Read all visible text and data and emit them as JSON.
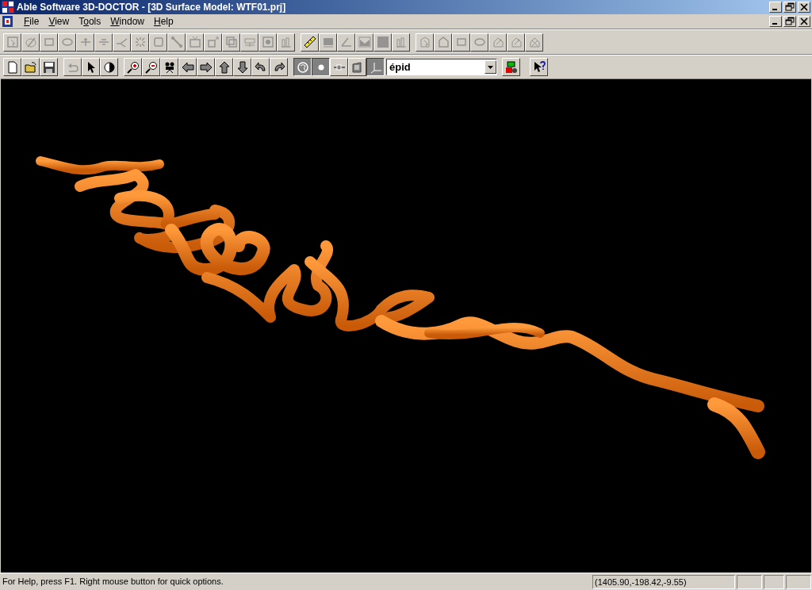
{
  "window": {
    "title": "Able Software 3D-DOCTOR - [3D Surface Model: WTF01.prj]"
  },
  "menu": [
    "File",
    "View",
    "Tools",
    "Window",
    "Help"
  ],
  "toolbar_1": [
    [
      {
        "kind": "region",
        "disabled": true
      },
      {
        "kind": "pencil",
        "disabled": true
      },
      {
        "kind": "rect",
        "disabled": true
      },
      {
        "kind": "ellipse",
        "disabled": true
      },
      {
        "kind": "add",
        "disabled": true
      },
      {
        "kind": "minus",
        "disabled": true
      },
      {
        "kind": "branch",
        "disabled": true
      },
      {
        "kind": "grid",
        "disabled": true
      },
      {
        "kind": "crop",
        "disabled": true
      },
      {
        "kind": "line",
        "disabled": true
      },
      {
        "kind": "screen",
        "disabled": true
      },
      {
        "kind": "resize",
        "disabled": true
      },
      {
        "kind": "overlap",
        "disabled": true
      },
      {
        "kind": "obj",
        "disabled": true
      },
      {
        "kind": "target",
        "disabled": true
      },
      {
        "kind": "chart",
        "disabled": true
      }
    ],
    [
      {
        "kind": "ruler",
        "disabled": false
      },
      {
        "kind": "mesh",
        "disabled": true
      },
      {
        "kind": "angle",
        "disabled": true
      },
      {
        "kind": "profile",
        "disabled": true
      },
      {
        "kind": "square",
        "disabled": true
      },
      {
        "kind": "chart",
        "disabled": true
      }
    ],
    [
      {
        "kind": "shapearrow",
        "disabled": true
      },
      {
        "kind": "pentagon",
        "disabled": true
      },
      {
        "kind": "rect",
        "disabled": true
      },
      {
        "kind": "ellipse",
        "disabled": true
      },
      {
        "kind": "shapeedit",
        "disabled": true
      },
      {
        "kind": "shapeedit",
        "disabled": true
      },
      {
        "kind": "shapedelete",
        "disabled": true
      }
    ]
  ],
  "toolbar_2": [
    [
      {
        "kind": "new",
        "disabled": false,
        "pressed": false
      },
      {
        "kind": "open",
        "disabled": false,
        "pressed": false
      },
      {
        "kind": "save",
        "disabled": false,
        "pressed": false
      }
    ],
    [
      {
        "kind": "undo",
        "disabled": true,
        "pressed": false
      },
      {
        "kind": "pointer",
        "disabled": false,
        "pressed": false
      },
      {
        "kind": "contrast",
        "disabled": false,
        "pressed": false
      }
    ],
    [
      {
        "kind": "zoomin",
        "disabled": false,
        "pressed": false
      },
      {
        "kind": "zoomout",
        "disabled": false,
        "pressed": false
      },
      {
        "kind": "camera",
        "disabled": false,
        "pressed": false
      },
      {
        "kind": "left",
        "disabled": false,
        "pressed": false
      },
      {
        "kind": "right",
        "disabled": false,
        "pressed": false
      },
      {
        "kind": "up",
        "disabled": false,
        "pressed": false
      },
      {
        "kind": "down",
        "disabled": false,
        "pressed": false
      },
      {
        "kind": "rotleft",
        "disabled": false,
        "pressed": false
      },
      {
        "kind": "rotright",
        "disabled": false,
        "pressed": false
      }
    ],
    [
      {
        "kind": "render",
        "disabled": false,
        "pressed": true
      },
      {
        "kind": "dot",
        "disabled": false,
        "pressed": true
      },
      {
        "kind": "slider",
        "disabled": false,
        "pressed": false
      },
      {
        "kind": "page",
        "disabled": false,
        "pressed": false
      },
      {
        "kind": "axes",
        "disabled": false,
        "pressed": true
      }
    ]
  ],
  "object_combo": {
    "value": "épid"
  },
  "toolbar_2_end": [
    {
      "kind": "colortool",
      "disabled": false,
      "pressed": false
    },
    {
      "kind": "help",
      "disabled": false,
      "pressed": false
    }
  ],
  "status_bar": {
    "message": "For Help, press F1. Right mouse button for quick options.",
    "coordinates": "(1405.90,-198.42,-9.55)"
  }
}
